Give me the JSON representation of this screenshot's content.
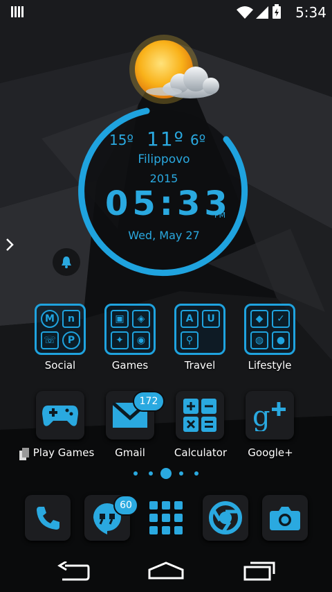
{
  "status_bar": {
    "time": "5:34",
    "icons": [
      "notification-icon",
      "wifi-icon",
      "signal-icon",
      "battery-charging-icon"
    ]
  },
  "weather_widget": {
    "temp_low": "15º",
    "temp_now": "11º",
    "temp_high": "6º",
    "city": "Filippovo",
    "year": "2015",
    "time": "05:33",
    "ampm": "PM",
    "date": "Wed, May 27",
    "icon": "partly-cloudy-icon"
  },
  "folders": [
    {
      "label": "Social"
    },
    {
      "label": "Games"
    },
    {
      "label": "Travel"
    },
    {
      "label": "Lifestyle"
    }
  ],
  "apps": [
    {
      "label": "Play Games",
      "icon": "gamepad-icon"
    },
    {
      "label": "Gmail",
      "icon": "mail-icon",
      "badge": "172"
    },
    {
      "label": "Calculator",
      "icon": "calculator-icon"
    },
    {
      "label": "Google+",
      "icon": "google-plus-icon"
    }
  ],
  "dock": [
    {
      "icon": "phone-icon"
    },
    {
      "icon": "hangouts-icon",
      "badge": "60"
    },
    {
      "icon": "app-drawer-icon"
    },
    {
      "icon": "chrome-icon"
    },
    {
      "icon": "camera-icon"
    }
  ],
  "page_indicator": {
    "count": 5,
    "current": 3
  },
  "nav": [
    "back-button",
    "home-button",
    "recents-button"
  ],
  "colors": {
    "accent": "#2aa9e0",
    "background": "#0c0d0f"
  }
}
